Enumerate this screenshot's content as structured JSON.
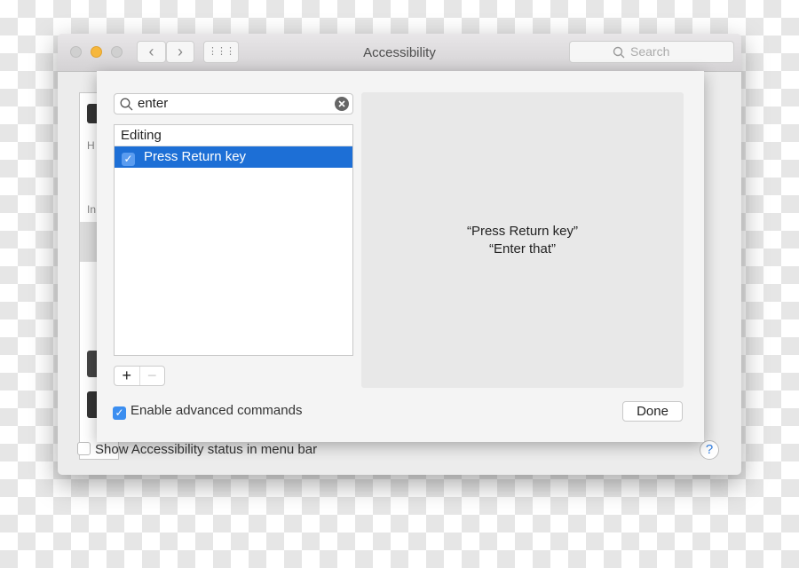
{
  "window": {
    "title": "Accessibility",
    "search_placeholder": "Search",
    "back": "‹",
    "forward": "›",
    "show_all": "⋮⋮⋮"
  },
  "sidebar": {
    "partial_labels": [
      "H",
      "In"
    ]
  },
  "footer": {
    "show_status_label": "Show Accessibility status in menu bar",
    "show_status_checked": false,
    "help": "?"
  },
  "sheet": {
    "search_value": "enter",
    "list": {
      "group": "Editing",
      "items": [
        {
          "label": "Press Return key",
          "checked": true,
          "selected": true
        }
      ]
    },
    "add": "+",
    "remove": "−",
    "detail_lines": [
      "“Press Return key”",
      "“Enter that”"
    ],
    "enable_advanced_label": "Enable advanced commands",
    "enable_advanced_checked": true,
    "done": "Done"
  },
  "colors": {
    "accent": "#1d6fd6",
    "checkbox": "#3b8ef0",
    "minimize": "#f6b73c"
  }
}
